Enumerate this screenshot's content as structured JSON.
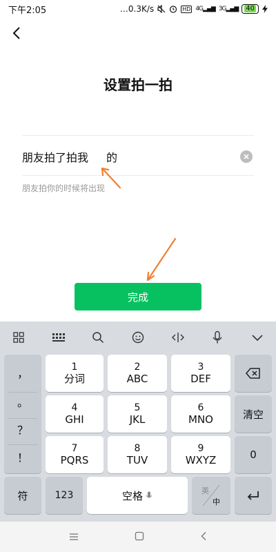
{
  "status_bar": {
    "time": "下午2:05",
    "net_speed": "…0.3K/s",
    "hd": "HD",
    "sig1": "4G",
    "sig2": "3G",
    "battery": "40"
  },
  "header": {
    "title": "设置拍一拍"
  },
  "input": {
    "prefix": "朋友拍了拍我",
    "value": "",
    "suffix": "的",
    "hint": "朋友拍你的时候将出现"
  },
  "done_button": {
    "label": "完成"
  },
  "accent_color": "#07c160",
  "annotation_color": "#f07f2f",
  "keyboard": {
    "toolbar_icons": [
      "grid-icon",
      "keyboard-icon",
      "search-icon",
      "emoji-icon",
      "cursor-icon",
      "mic-icon",
      "collapse-icon"
    ],
    "left_column": [
      "，",
      "。",
      "？",
      "！"
    ],
    "keys": {
      "k1": {
        "num": "1",
        "letters": "分词"
      },
      "k2": {
        "num": "2",
        "letters": "ABC"
      },
      "k3": {
        "num": "3",
        "letters": "DEF"
      },
      "k4": {
        "num": "4",
        "letters": "GHI"
      },
      "k5": {
        "num": "5",
        "letters": "JKL"
      },
      "k6": {
        "num": "6",
        "letters": "MNO"
      },
      "k7": {
        "num": "7",
        "letters": "PQRS"
      },
      "k8": {
        "num": "8",
        "letters": "TUV"
      },
      "k9": {
        "num": "9",
        "letters": "WXYZ"
      }
    },
    "clear": "清空",
    "zero": "0",
    "symbol": "符",
    "num_toggle": "123",
    "space": "空格",
    "lang_en": "英",
    "lang_zh": "中"
  }
}
